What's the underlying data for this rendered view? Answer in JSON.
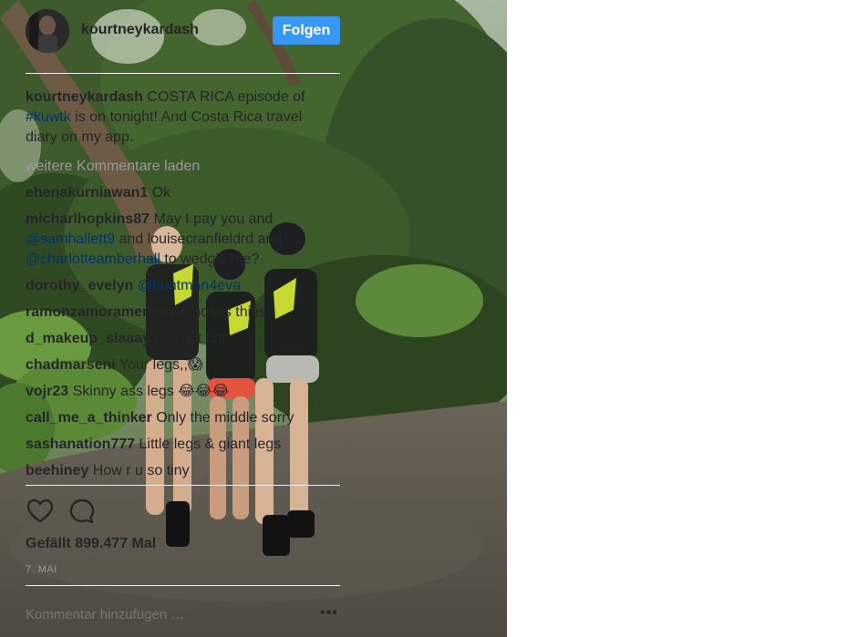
{
  "post": {
    "username": "kourtneykardash",
    "follow_label": "Folgen",
    "caption_user": "kourtneykardash",
    "caption_text_1": " COSTA RICA episode of ",
    "caption_hashtag": "#kuwtk",
    "caption_text_2": " is on tonight! And Costa Rica travel diary on my app.",
    "load_more": "weitere Kommentare laden",
    "likes": "Gefällt 899.477 Mal",
    "date": "7. MAI",
    "add_comment_placeholder": "Kommentar hinzufügen …",
    "more_options": "•••"
  },
  "comments": [
    {
      "user": "ehenakurniawan1",
      "text": " Ok"
    },
    {
      "user": "micharlhopkins87",
      "text_1": " May I pay you and ",
      "mention_1": "@samhallett9",
      "text_2": " and louisecranfieldrd and ",
      "mention_2": "@charlotteamberhall",
      "text_3": " to wedgie me?"
    },
    {
      "user": "dorothy_evelyn",
      "mention": "@huntman4eva"
    },
    {
      "user": "ramonzamoramendoza",
      "text": " thoses thies"
    },
    {
      "user": "d_makeup_slaaay",
      "text": " Hot hot hot"
    },
    {
      "user": "chadmarseni",
      "text": " Your legs,,😱"
    },
    {
      "user": "vojr23",
      "text": " Skinny ass legs 😂😂😂"
    },
    {
      "user": "call_me_a_thinker",
      "text": " Only the middle sorry"
    },
    {
      "user": "sashanation777",
      "text": " Little legs & giant legs"
    },
    {
      "user": "beehiney",
      "text": " How r u so tiny"
    }
  ],
  "icons": {
    "like": "heart-outline-icon",
    "comment": "speech-bubble-icon"
  },
  "colors": {
    "follow_button": "#3897f0",
    "link": "#003569",
    "muted": "#999999"
  }
}
